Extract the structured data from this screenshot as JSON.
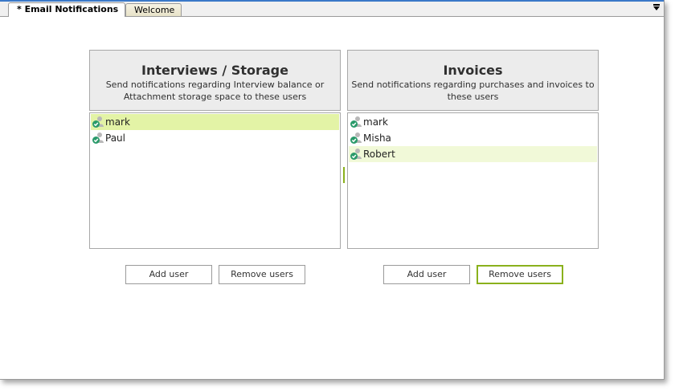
{
  "tabs": [
    {
      "label": "* Email Notifications",
      "active": true
    },
    {
      "label": "Welcome",
      "active": false
    }
  ],
  "panels": {
    "interviews": {
      "title": "Interviews / Storage",
      "description": "Send notifications regarding Interview balance or Attachment storage space to these users",
      "users": [
        "mark",
        "Paul"
      ],
      "add_label": "Add user",
      "remove_label": "Remove users"
    },
    "invoices": {
      "title": "Invoices",
      "description": "Send notifications regarding purchases and invoices to these users",
      "users": [
        "mark",
        "Misha",
        "Robert"
      ],
      "add_label": "Add user",
      "remove_label": "Remove users"
    }
  },
  "icons": {
    "user": "user-check-icon",
    "tab_menu": "tab-list-menu-icon"
  },
  "colors": {
    "accent": "#8ab11c",
    "selected_row": "#e3f3a6",
    "hover_row": "#f1f9d8",
    "header_bg": "#ececec",
    "check_green": "#2a9a6a",
    "tab_strip_line": "#3a78c8"
  }
}
